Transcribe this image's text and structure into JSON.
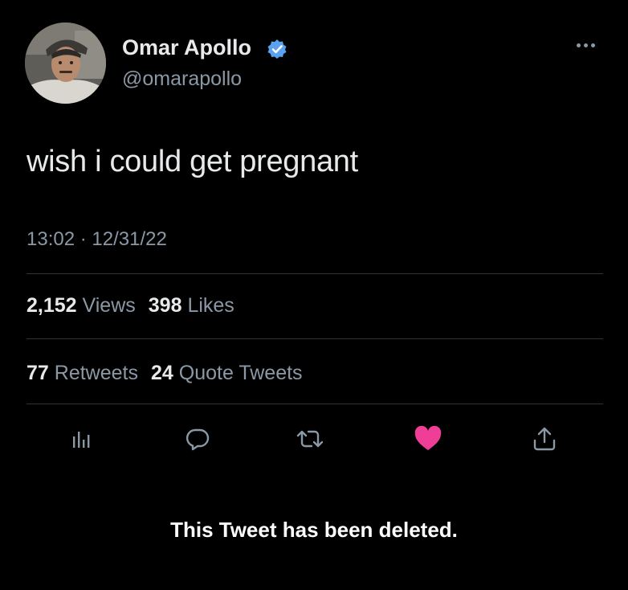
{
  "author": {
    "name": "Omar Apollo",
    "handle": "@omarapollo",
    "verified_color": "#5aa2ef"
  },
  "tweet": {
    "text": "wish i could get pregnant",
    "timestamp": "13:02 · 12/31/22"
  },
  "stats_row1": [
    {
      "count": "2,152",
      "label": "Views"
    },
    {
      "count": "398",
      "label": "Likes"
    }
  ],
  "stats_row2": [
    {
      "count": "77",
      "label": "Retweets"
    },
    {
      "count": "24",
      "label": "Quote Tweets"
    }
  ],
  "actions": [
    {
      "icon": "analytics-icon"
    },
    {
      "icon": "reply-icon"
    },
    {
      "icon": "retweet-icon"
    },
    {
      "icon": "heart-icon",
      "color": "#f03e96"
    },
    {
      "icon": "share-icon"
    }
  ],
  "status_message": "This Tweet has been deleted.",
  "colors": {
    "background": "#000000",
    "primary_text": "#e7e9ea",
    "secondary_text": "#8b98a5",
    "divider": "#2f3336",
    "liked_heart": "#f03e96"
  }
}
